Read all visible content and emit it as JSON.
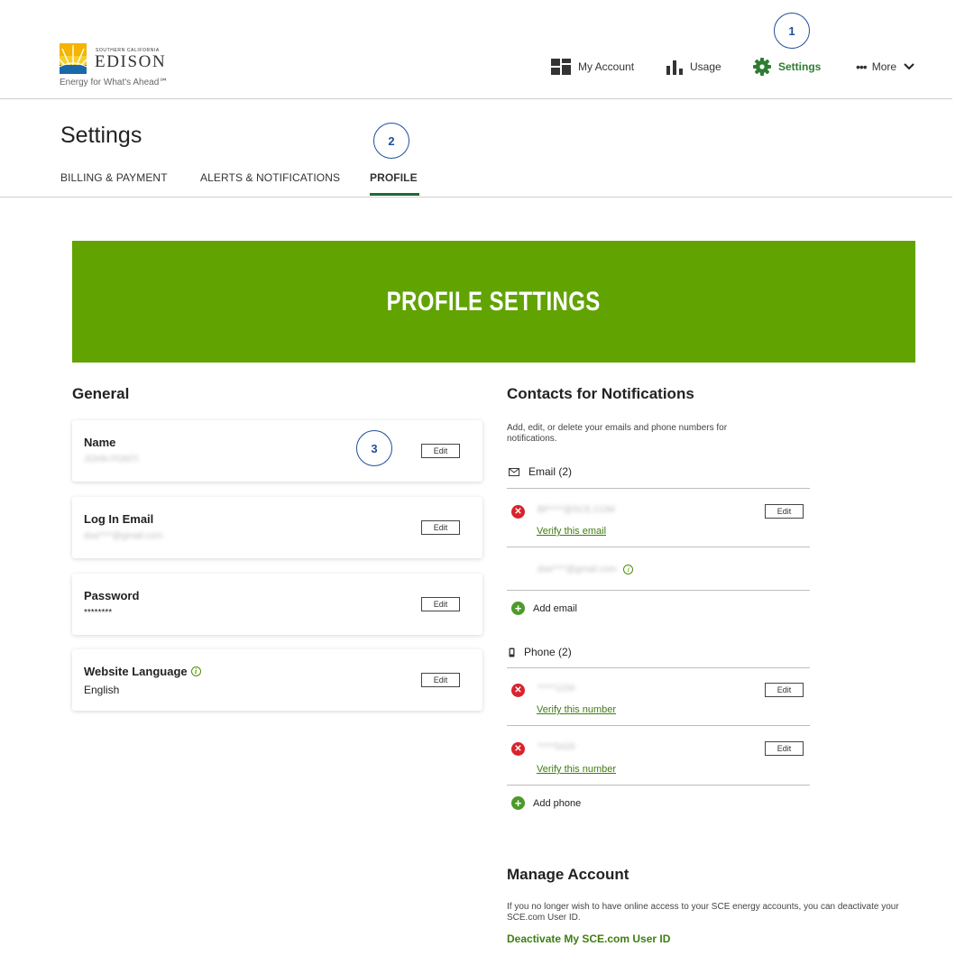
{
  "brand": {
    "small_text": "Southern California",
    "name": "EDISON",
    "tagline": "Energy for What's Ahead℠",
    "colors": {
      "primary_green": "#61a301",
      "link_green": "#3f7d10",
      "error_red": "#d9232d",
      "callout_blue": "#1f4e9a"
    }
  },
  "nav": {
    "items": [
      {
        "label": "My Account",
        "icon": "dashboard-icon"
      },
      {
        "label": "Usage",
        "icon": "bar-chart-icon"
      },
      {
        "label": "Settings",
        "icon": "gear-icon",
        "active": true
      },
      {
        "label": "More",
        "icon": "more-dots-icon"
      }
    ]
  },
  "callouts": [
    "1",
    "2",
    "3"
  ],
  "page": {
    "title": "Settings",
    "tabs": [
      {
        "label": "BILLING & PAYMENT"
      },
      {
        "label": "ALERTS & NOTIFICATIONS"
      },
      {
        "label": "PROFILE",
        "active": true
      }
    ]
  },
  "banner": {
    "title": "PROFILE SETTINGS"
  },
  "general": {
    "title": "General",
    "cards": [
      {
        "label": "Name",
        "value": "JOHN PONTI",
        "edit_label": "Edit"
      },
      {
        "label": "Log In Email",
        "value": "dsa****@gmail.com",
        "edit_label": "Edit"
      },
      {
        "label": "Password",
        "value": "********",
        "edit_label": "Edit"
      },
      {
        "label": "Website Language",
        "value": "English",
        "edit_label": "Edit",
        "info_icon": "info-icon"
      }
    ]
  },
  "contacts": {
    "title": "Contacts for Notifications",
    "description": "Add, edit, or delete your emails and phone numbers for notifications.",
    "email": {
      "heading": "Email (2)",
      "icon": "envelope-icon",
      "items": [
        {
          "value": "BP****@SCE.COM",
          "verify_label": "Verify this email",
          "edit_label": "Edit",
          "status_icon": "x-icon"
        },
        {
          "value": "dsa****@gmail.com",
          "info_icon": "info-icon"
        }
      ],
      "add_label": "Add email"
    },
    "phone": {
      "heading": "Phone (2)",
      "icon": "phone-icon",
      "items": [
        {
          "value": "*****1234",
          "verify_label": "Verify this number",
          "edit_label": "Edit",
          "status_icon": "x-icon"
        },
        {
          "value": "*****5420",
          "verify_label": "Verify this number",
          "edit_label": "Edit",
          "status_icon": "x-icon"
        }
      ],
      "add_label": "Add phone"
    }
  },
  "manage": {
    "title": "Manage Account",
    "description": "If you no longer wish to have online access to your SCE energy accounts, you can deactivate your SCE.com User ID.",
    "link_label": "Deactivate My SCE.com User ID"
  }
}
